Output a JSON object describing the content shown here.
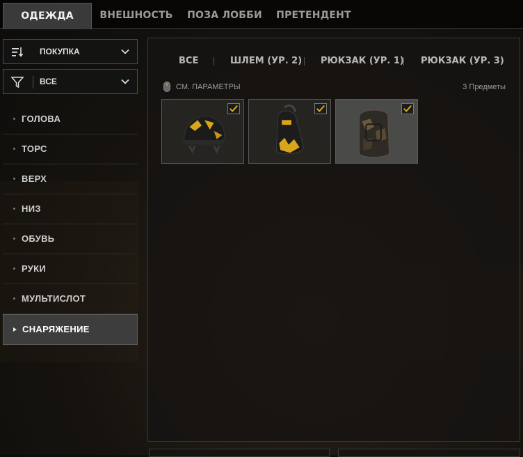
{
  "top_tabs": [
    {
      "label": "ОДЕЖДА",
      "active": true
    },
    {
      "label": "ВНЕШНОСТЬ",
      "active": false
    },
    {
      "label": "ПОЗА ЛОББИ",
      "active": false
    },
    {
      "label": "ПРЕТЕНДЕНТ",
      "active": false
    }
  ],
  "sort_dropdown": {
    "icon": "sort-icon",
    "value": "ПОКУПКА"
  },
  "filter_dropdown": {
    "icon": "filter-icon",
    "value": "ВСЕ"
  },
  "categories": [
    {
      "label": "ГОЛОВА",
      "active": false
    },
    {
      "label": "ТОРС",
      "active": false
    },
    {
      "label": "ВЕРХ",
      "active": false
    },
    {
      "label": "НИЗ",
      "active": false
    },
    {
      "label": "ОБУВЬ",
      "active": false
    },
    {
      "label": "РУКИ",
      "active": false
    },
    {
      "label": "МУЛЬТИСЛОТ",
      "active": false
    },
    {
      "label": "СНАРЯЖЕНИЕ",
      "active": true
    }
  ],
  "sub_tabs": [
    {
      "label": "ВСЕ"
    },
    {
      "label": "ШЛЕМ (УР. 2)"
    },
    {
      "label": "РЮКЗАК (УР. 1)"
    },
    {
      "label": "РЮКЗАК (УР. 3)"
    }
  ],
  "params_hint": {
    "icon": "mouse-icon",
    "text": "СМ. ПАРАМЕТРЫ"
  },
  "item_count": "3 Предметы",
  "items": [
    {
      "name": "helmet-level-2",
      "equipped": true
    },
    {
      "name": "backpack-level-1",
      "equipped": true
    },
    {
      "name": "backpack-level-3",
      "equipped": true
    }
  ],
  "colors": {
    "accent": "#e0b21c",
    "panel_border": "#3a3a3a"
  }
}
